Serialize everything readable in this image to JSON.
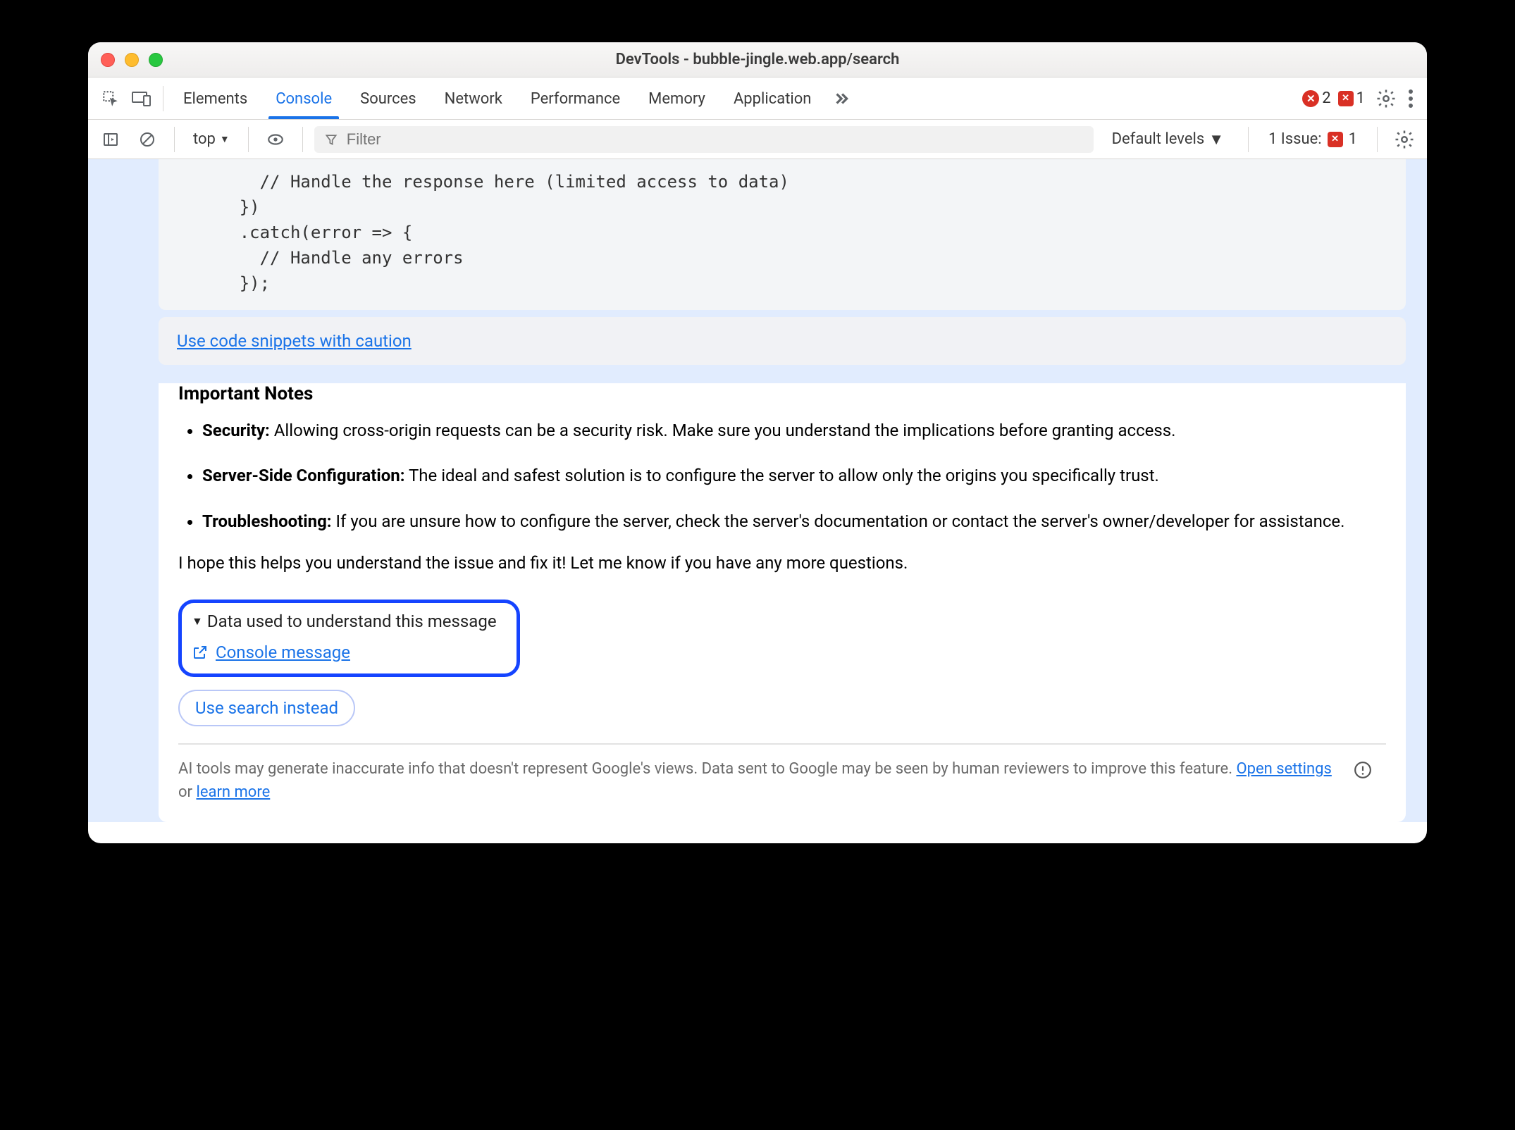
{
  "window": {
    "title": "DevTools - bubble-jingle.web.app/search"
  },
  "tabs": {
    "elements": "Elements",
    "console": "Console",
    "sources": "Sources",
    "network": "Network",
    "performance": "Performance",
    "memory": "Memory",
    "application": "Application"
  },
  "badges": {
    "errors": "2",
    "issues": "1"
  },
  "toolbar2": {
    "context": "top",
    "filter_placeholder": "Filter",
    "levels": "Default levels",
    "issues_label": "1 Issue:",
    "issues_count": "1"
  },
  "code": "        // Handle the response here (limited access to data)\n      })\n      .catch(error => {\n        // Handle any errors\n      });",
  "caution_link": "Use code snippets with caution",
  "section_title": "Important Notes",
  "notes": {
    "n1_b": "Security:",
    "n1_t": " Allowing cross-origin requests can be a security risk. Make sure you understand the implications before granting access.",
    "n2_b": "Server-Side Configuration:",
    "n2_t": " The ideal and safest solution is to configure the server to allow only the origins you specifically trust.",
    "n3_b": "Troubleshooting:",
    "n3_t": " If you are unsure how to configure the server, check the server's documentation or contact the server's owner/developer for assistance."
  },
  "closing": "I hope this helps you understand the issue and fix it! Let me know if you have any more questions.",
  "callout": {
    "title": "Data used to understand this message",
    "link": "Console message"
  },
  "pill": "Use search instead",
  "footer": {
    "text_a": "AI tools may generate inaccurate info that doesn't represent Google's views. Data sent to Google may be seen by human reviewers to improve this feature. ",
    "link1": "Open settings",
    "or": " or ",
    "link2": "learn more"
  }
}
